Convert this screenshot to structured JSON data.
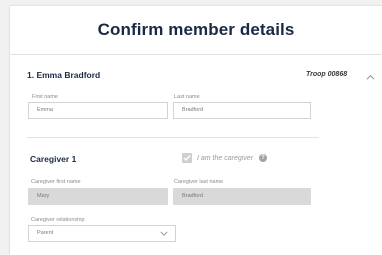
{
  "header": {
    "title": "Confirm member details"
  },
  "member": {
    "heading": "1. Emma Bradford",
    "troop": "Troop 00868",
    "first_name": {
      "label": "First name",
      "value": "Emma"
    },
    "last_name": {
      "label": "Last name",
      "value": "Bradford"
    }
  },
  "caregiver": {
    "heading": "Caregiver 1",
    "is_caregiver_label": "I am the caregiver",
    "is_caregiver_checked": true,
    "first_name": {
      "label": "Caregiver first name",
      "value": "Mary"
    },
    "last_name": {
      "label": "Caregiver last name",
      "value": "Bradford"
    },
    "relationship": {
      "label": "Caregiver relationship",
      "value": "Parent"
    }
  },
  "icons": {
    "collapse": "chevron-up-icon",
    "help": "help-icon",
    "checkbox": "check-icon",
    "dropdown": "chevron-down-icon"
  },
  "colors": {
    "heading": "#1b2a44",
    "disabled_field": "#d9d9d9",
    "border": "#d3d3d3"
  }
}
